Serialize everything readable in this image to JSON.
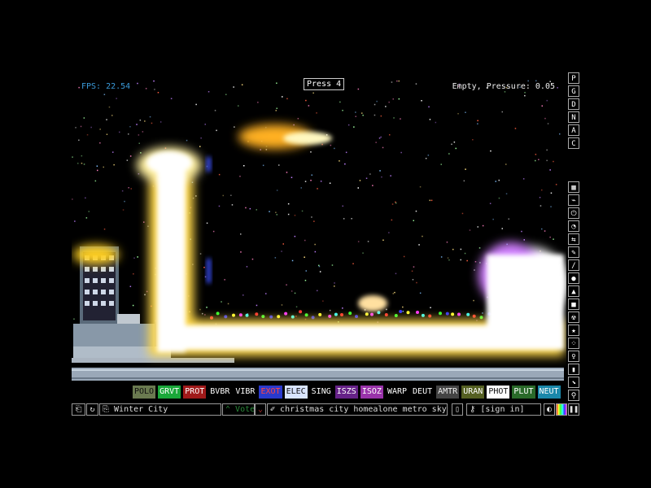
{
  "hud": {
    "fps": "FPS: 22.54",
    "status": "Empty, Pressure: 0.05",
    "press": "Press 4"
  },
  "right_menu_top": [
    "P",
    "G",
    "D",
    "N",
    "A",
    "C"
  ],
  "right_menu_icons": [
    "wall-icon",
    "electronics-icon",
    "power-icon",
    "sensor-icon",
    "force-icon",
    "explosive-icon",
    "gas-icon",
    "liquid-icon",
    "powder-icon",
    "solid-icon",
    "radioactive-icon",
    "special-icon",
    "particles-icon",
    "life-icon",
    "tools-icon",
    "favorite-icon",
    "search-icon"
  ],
  "elements": [
    {
      "label": "POLO",
      "bg": "#6a7a50",
      "fg": "#111"
    },
    {
      "label": "GRVT",
      "bg": "#1aa83a",
      "fg": "#fff"
    },
    {
      "label": "PROT",
      "bg": "#a01a1a",
      "fg": "#fff"
    },
    {
      "label": "BVBR",
      "bg": "#000",
      "fg": "#fff"
    },
    {
      "label": "VIBR",
      "bg": "#000",
      "fg": "#fff"
    },
    {
      "label": "EXOT",
      "bg": "#2a3acc",
      "fg": "#f44"
    },
    {
      "label": "ELEC",
      "bg": "#d8e4ff",
      "fg": "#111"
    },
    {
      "label": "SING",
      "bg": "#000",
      "fg": "#fff"
    },
    {
      "label": "ISZS",
      "bg": "#662288",
      "fg": "#fff"
    },
    {
      "label": "ISOZ",
      "bg": "#9933aa",
      "fg": "#fff"
    },
    {
      "label": "WARP",
      "bg": "#000",
      "fg": "#fff"
    },
    {
      "label": "DEUT",
      "bg": "#000",
      "fg": "#fff"
    },
    {
      "label": "AMTR",
      "bg": "#444",
      "fg": "#eee"
    },
    {
      "label": "URAN",
      "bg": "#556022",
      "fg": "#fff"
    },
    {
      "label": "PHOT",
      "bg": "#fff",
      "fg": "#111"
    },
    {
      "label": "PLUT",
      "bg": "#2a6a2a",
      "fg": "#fff"
    },
    {
      "label": "NEUT",
      "bg": "#1a88aa",
      "fg": "#fff"
    }
  ],
  "bottom": {
    "save_name": "Winter City",
    "vote_label": "Vote",
    "tags": "christmas city homealone metro skyscrap...",
    "signin": "[sign in]"
  },
  "colors": {
    "fps": "#3a9ad9",
    "vote_up": "#2a8a3a",
    "vote_down": "#aa2a2a"
  }
}
